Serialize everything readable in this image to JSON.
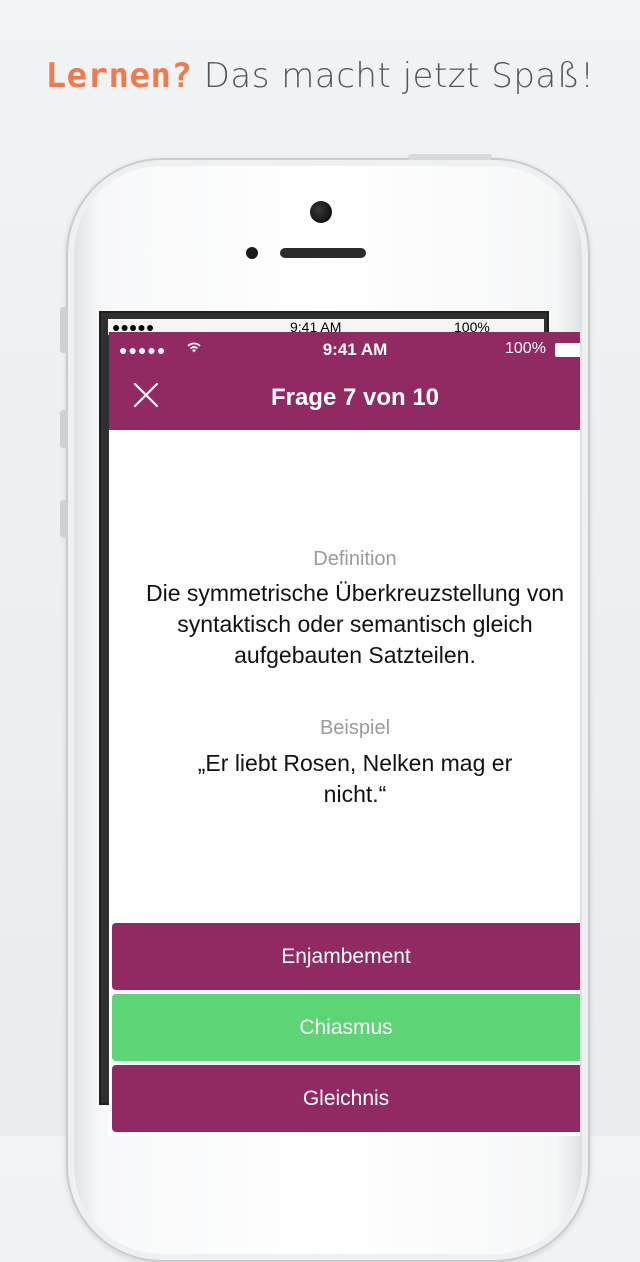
{
  "headline": {
    "accent": "Lernen?",
    "rest": " Das macht jetzt Spaß!"
  },
  "back_status": {
    "dots": "●●●●● ",
    "time": "9:41 AM",
    "battery": "100%"
  },
  "status_bar": {
    "signal": "●●●●●",
    "wifi": "wifi-icon",
    "time": "9:41 AM",
    "battery_text": "100%"
  },
  "nav": {
    "close_icon": "close-icon",
    "title": "Frage 7 von 10"
  },
  "question": {
    "definition_label": "Definition",
    "definition_text": "Die symmetrische Überkreuzstellung von syntaktisch oder semantisch gleich aufgebauten Satzteilen.",
    "example_label": "Beispiel",
    "example_text": "„Er liebt Rosen, Nelken mag er nicht.“"
  },
  "answers": [
    {
      "label": "Enjambement",
      "state": "default",
      "color": "#912962"
    },
    {
      "label": "Chiasmus",
      "state": "correct",
      "color": "#5cd574"
    },
    {
      "label": "Gleichnis",
      "state": "default",
      "color": "#912962"
    }
  ],
  "colors": {
    "accent": "#f07a4a",
    "brand": "#912962",
    "correct": "#5cd574"
  }
}
